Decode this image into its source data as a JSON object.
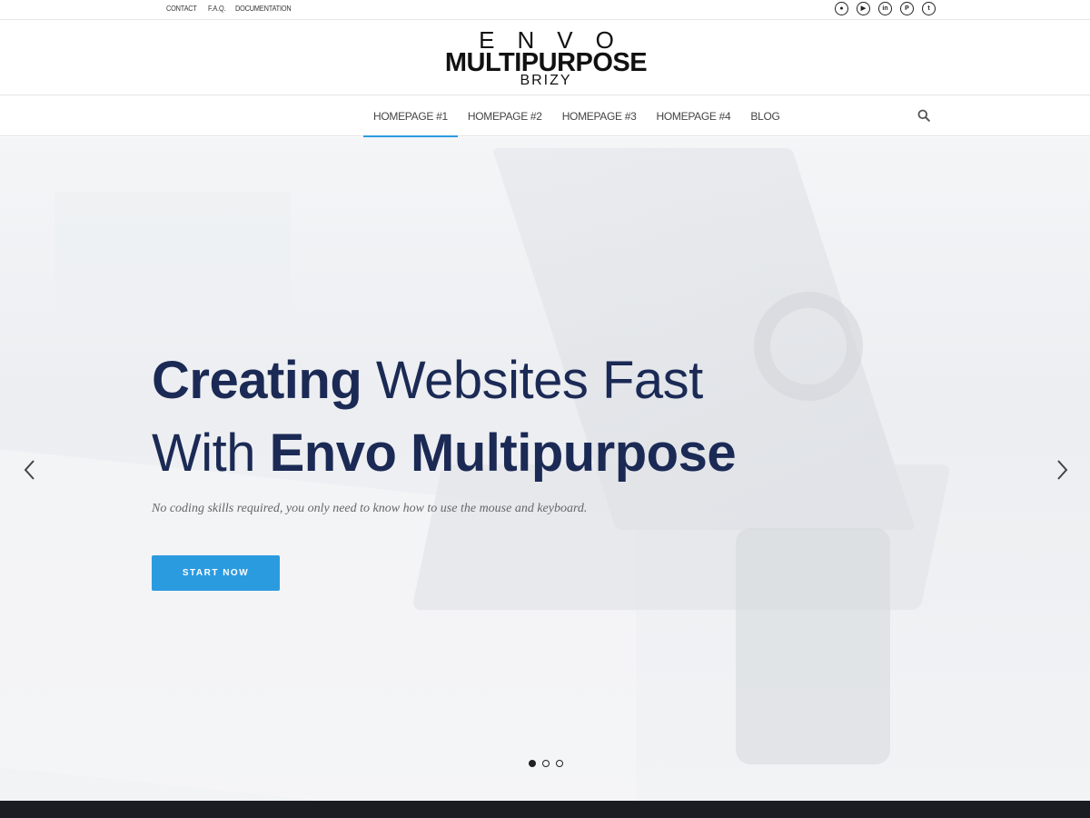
{
  "topbar": {
    "links": [
      "CONTACT",
      "F.A.Q.",
      "DOCUMENTATION"
    ],
    "social_icons": [
      "reddit-icon",
      "youtube-icon",
      "linkedin-icon",
      "pinterest-icon",
      "twitter-icon"
    ]
  },
  "logo": {
    "line1": "ENVO",
    "line2": "MULTIPURPOSE",
    "line3": "BRIZY"
  },
  "nav": {
    "items": [
      {
        "label": "HOMEPAGE #1",
        "active": true
      },
      {
        "label": "HOMEPAGE #2",
        "active": false
      },
      {
        "label": "HOMEPAGE #3",
        "active": false
      },
      {
        "label": "HOMEPAGE #4",
        "active": false
      },
      {
        "label": "BLOG",
        "active": false
      }
    ]
  },
  "hero": {
    "headline_line1_bold": "Creating",
    "headline_line1_thin": " Websites Fast",
    "headline_line2_thin": "With ",
    "headline_line2_bold": "Envo Multipurpose",
    "subtext": "No coding skills required, you only need to know how to use the mouse and keyboard.",
    "cta_label": "START NOW",
    "slides": 3,
    "active_slide": 1
  },
  "colors": {
    "accent": "#2b9be0",
    "headline": "#1b2a55",
    "footer": "#1b1c22"
  }
}
